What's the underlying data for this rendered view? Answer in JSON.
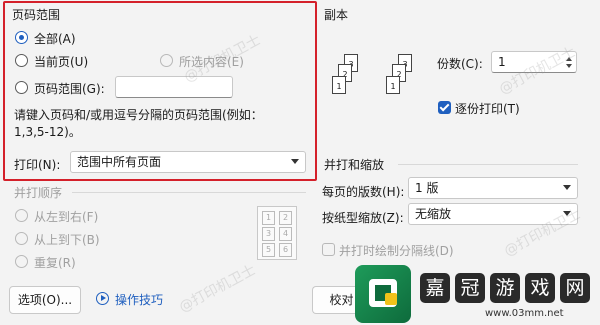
{
  "page_range": {
    "title": "页码范围",
    "all_label": "全部(A)",
    "current_label": "当前页(U)",
    "selection_label": "所选内容(E)",
    "pages_label": "页码范围(G):",
    "pages_value": "",
    "hint": "请键入页码和/或用逗号分隔的页码范围(例如：",
    "hint2": "1,3,5-12)。"
  },
  "print_what": {
    "label": "打印(N):",
    "value": "范围中所有页面"
  },
  "collate_order": {
    "title": "并打顺序",
    "left_to_right": "从左到右(F)",
    "top_to_bottom": "从上到下(B)",
    "repeat": "重复(R)",
    "grid": [
      "1",
      "2",
      "3",
      "4",
      "5",
      "6"
    ]
  },
  "copies": {
    "title": "副本",
    "count_label": "份数(C):",
    "count_value": "1",
    "collate_label": "逐份打印(T)"
  },
  "zoom": {
    "title": "并打和缩放",
    "pages_per_sheet_label": "每页的版数(H):",
    "pages_per_sheet_value": "1 版",
    "scale_label": "按纸型缩放(Z):",
    "scale_value": "无缩放",
    "draw_borders_label": "并打时绘制分隔线(D)"
  },
  "footer": {
    "options_label": "选项(O)...",
    "tips_label": "操作技巧",
    "proof_label": "校对"
  },
  "overlay": {
    "brand_chars": [
      "嘉",
      "冠",
      "游",
      "戏",
      "网"
    ],
    "url": "www.03mm.net",
    "watermark": "@打印机卫士"
  },
  "colors": {
    "accent": "#1f5fbf",
    "highlight": "#d4202a"
  }
}
